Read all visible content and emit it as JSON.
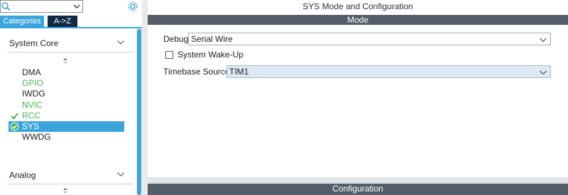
{
  "search": {
    "value": "",
    "placeholder": ""
  },
  "tabs": {
    "categories": "Categories",
    "az": "A->Z"
  },
  "groups": {
    "system_core": "System Core",
    "analog": "Analog"
  },
  "peripherals": [
    {
      "label": "DMA",
      "status": "none",
      "color": "#222222"
    },
    {
      "label": "GPIO",
      "status": "none",
      "color": "#4caf50"
    },
    {
      "label": "IWDG",
      "status": "none",
      "color": "#222222"
    },
    {
      "label": "NVIC",
      "status": "none",
      "color": "#4caf50"
    },
    {
      "label": "RCC",
      "status": "check",
      "color": "#4caf50"
    },
    {
      "label": "SYS",
      "status": "check-circle",
      "color": "#ffffff",
      "selected": true
    },
    {
      "label": "WWDG",
      "status": "none",
      "color": "#222222"
    }
  ],
  "right_panel": {
    "title": "SYS Mode and Configuration",
    "mode_header": "Mode",
    "config_header": "Configuration",
    "debug": {
      "label": "Debug",
      "value": "Serial Wire"
    },
    "wakeup": {
      "label": "System Wake-Up",
      "checked": false
    },
    "timebase": {
      "label": "Timebase Source",
      "value": "TIM1"
    }
  },
  "colors": {
    "accent": "#3ba5db",
    "tab_dark": "#0f2a45",
    "header_bar": "#545e6b",
    "enabled_green": "#4caf50"
  },
  "icons": [
    "search-icon",
    "gear-icon",
    "chevron-down-icon",
    "sort-icon",
    "check-icon",
    "check-circle-icon"
  ]
}
